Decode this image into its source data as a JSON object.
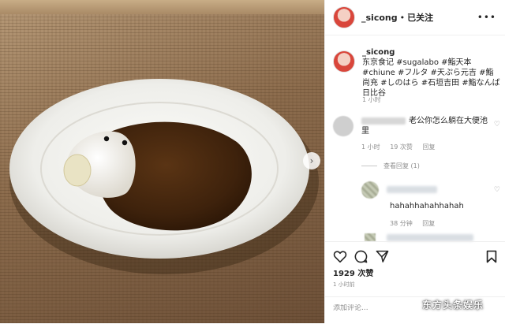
{
  "header": {
    "username": "_sicong",
    "separator": "•",
    "follow_state": "已关注",
    "more_icon": "more-horizontal-icon"
  },
  "caption": {
    "username": "_sicong",
    "text": "东京食记 #sugalabo #鮨天本 #chiune #フルタ #天ぷら元吉 #鮨尚充 #しのはら #石垣吉田 #鮨なんば日比谷",
    "time": "1 小时"
  },
  "comments": [
    {
      "text": "老公你怎么躺在大便池里",
      "time": "1 小时",
      "likes": "19 次赞",
      "reply": "回复",
      "view_replies": "查看回复 (1)"
    },
    {
      "text": "hahahhahahhahah",
      "time": "38 分钟",
      "reply": "回复"
    }
  ],
  "actions": {
    "like_icon": "heart-icon",
    "comment_icon": "comment-icon",
    "share_icon": "share-icon",
    "save_icon": "bookmark-icon"
  },
  "likes": "1929 次赞",
  "post_time": "1 小时前",
  "comment_box": {
    "placeholder": "添加评论..."
  },
  "watermark": "东方头条娱乐",
  "photo": {
    "next_icon": "chevron-right-icon"
  }
}
